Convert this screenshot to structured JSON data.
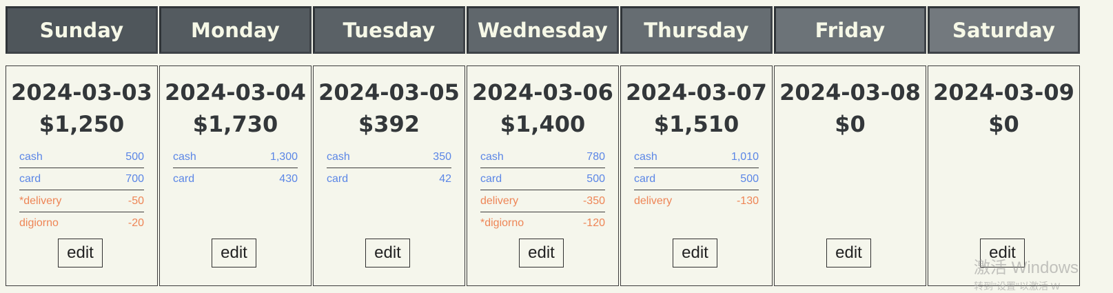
{
  "days": [
    {
      "name": "Sunday",
      "header_color": "#4f565b",
      "date": "2024-03-03",
      "total": "$1,250",
      "entries": [
        {
          "label": "cash",
          "amount": "500",
          "kind": "pos"
        },
        {
          "label": "card",
          "amount": "700",
          "kind": "pos"
        },
        {
          "label": "*delivery",
          "amount": "-50",
          "kind": "neg"
        },
        {
          "label": "digiorno",
          "amount": "-20",
          "kind": "neg"
        }
      ],
      "edit_label": "edit"
    },
    {
      "name": "Monday",
      "header_color": "#545b60",
      "date": "2024-03-04",
      "total": "$1,730",
      "entries": [
        {
          "label": "cash",
          "amount": "1,300",
          "kind": "pos"
        },
        {
          "label": "card",
          "amount": "430",
          "kind": "pos"
        }
      ],
      "edit_label": "edit"
    },
    {
      "name": "Tuesday",
      "header_color": "#5a6166",
      "date": "2024-03-05",
      "total": "$392",
      "entries": [
        {
          "label": "cash",
          "amount": "350",
          "kind": "pos"
        },
        {
          "label": "card",
          "amount": "42",
          "kind": "pos"
        }
      ],
      "edit_label": "edit"
    },
    {
      "name": "Wednesday",
      "header_color": "#60676c",
      "date": "2024-03-06",
      "total": "$1,400",
      "entries": [
        {
          "label": "cash",
          "amount": "780",
          "kind": "pos"
        },
        {
          "label": "card",
          "amount": "500",
          "kind": "pos"
        },
        {
          "label": "delivery",
          "amount": "-350",
          "kind": "neg"
        },
        {
          "label": "*digiorno",
          "amount": "-120",
          "kind": "neg"
        }
      ],
      "edit_label": "edit"
    },
    {
      "name": "Thursday",
      "header_color": "#666d72",
      "date": "2024-03-07",
      "total": "$1,510",
      "entries": [
        {
          "label": "cash",
          "amount": "1,010",
          "kind": "pos"
        },
        {
          "label": "card",
          "amount": "500",
          "kind": "pos"
        },
        {
          "label": "delivery",
          "amount": "-130",
          "kind": "neg"
        }
      ],
      "edit_label": "edit"
    },
    {
      "name": "Friday",
      "header_color": "#6c7378",
      "date": "2024-03-08",
      "total": "$0",
      "entries": [],
      "edit_label": "edit"
    },
    {
      "name": "Saturday",
      "header_color": "#73797e",
      "date": "2024-03-09",
      "total": "$0",
      "entries": [],
      "edit_label": "edit"
    }
  ],
  "colors": {
    "background": "#f5f6ec",
    "positive": "#5b86e6",
    "negative": "#ee8556",
    "header_text": "#f6f8e7"
  },
  "watermark": {
    "line1": "激活 Windows",
    "line2": "转到\"设置\"以激活 W"
  }
}
